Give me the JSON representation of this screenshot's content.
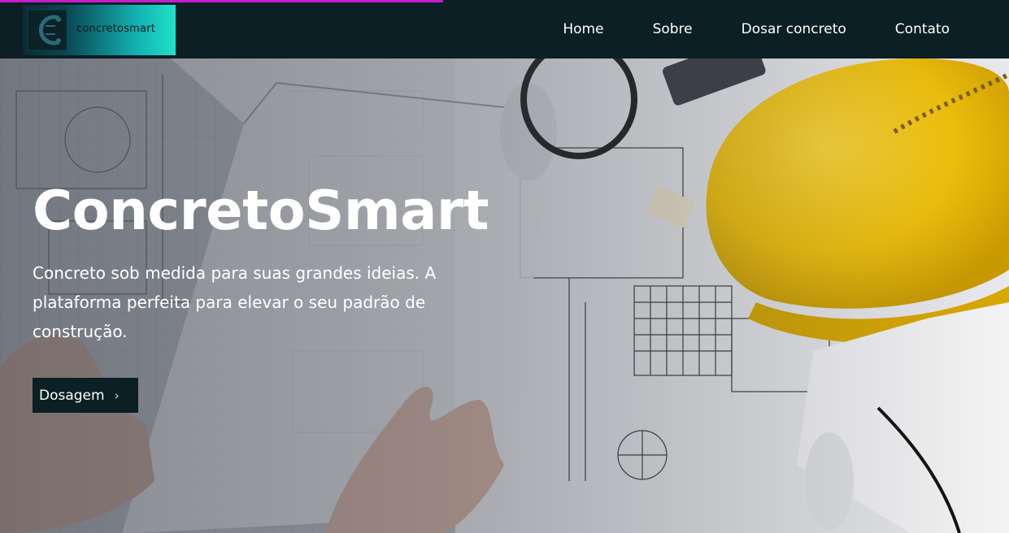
{
  "header": {
    "logo_text": "concretosmart",
    "nav": [
      {
        "label": "Home"
      },
      {
        "label": "Sobre"
      },
      {
        "label": "Dosar concreto"
      },
      {
        "label": "Contato"
      }
    ]
  },
  "hero": {
    "title": "ConcretoSmart",
    "subtitle": "Concreto sob medida para suas grandes ideias. A plataforma perfeita para elevar o seu padrão de construção.",
    "cta_label": "Dosagem",
    "cta_icon": "chevron-right-icon",
    "background_image": "architect-blueprints-with-hard-hat"
  },
  "colors": {
    "nav_background": "#0c1f24",
    "progress_accent": "#c41ec9",
    "logo_gradient_end": "#1fe0c8",
    "helmet_yellow": "#f2c20a"
  }
}
